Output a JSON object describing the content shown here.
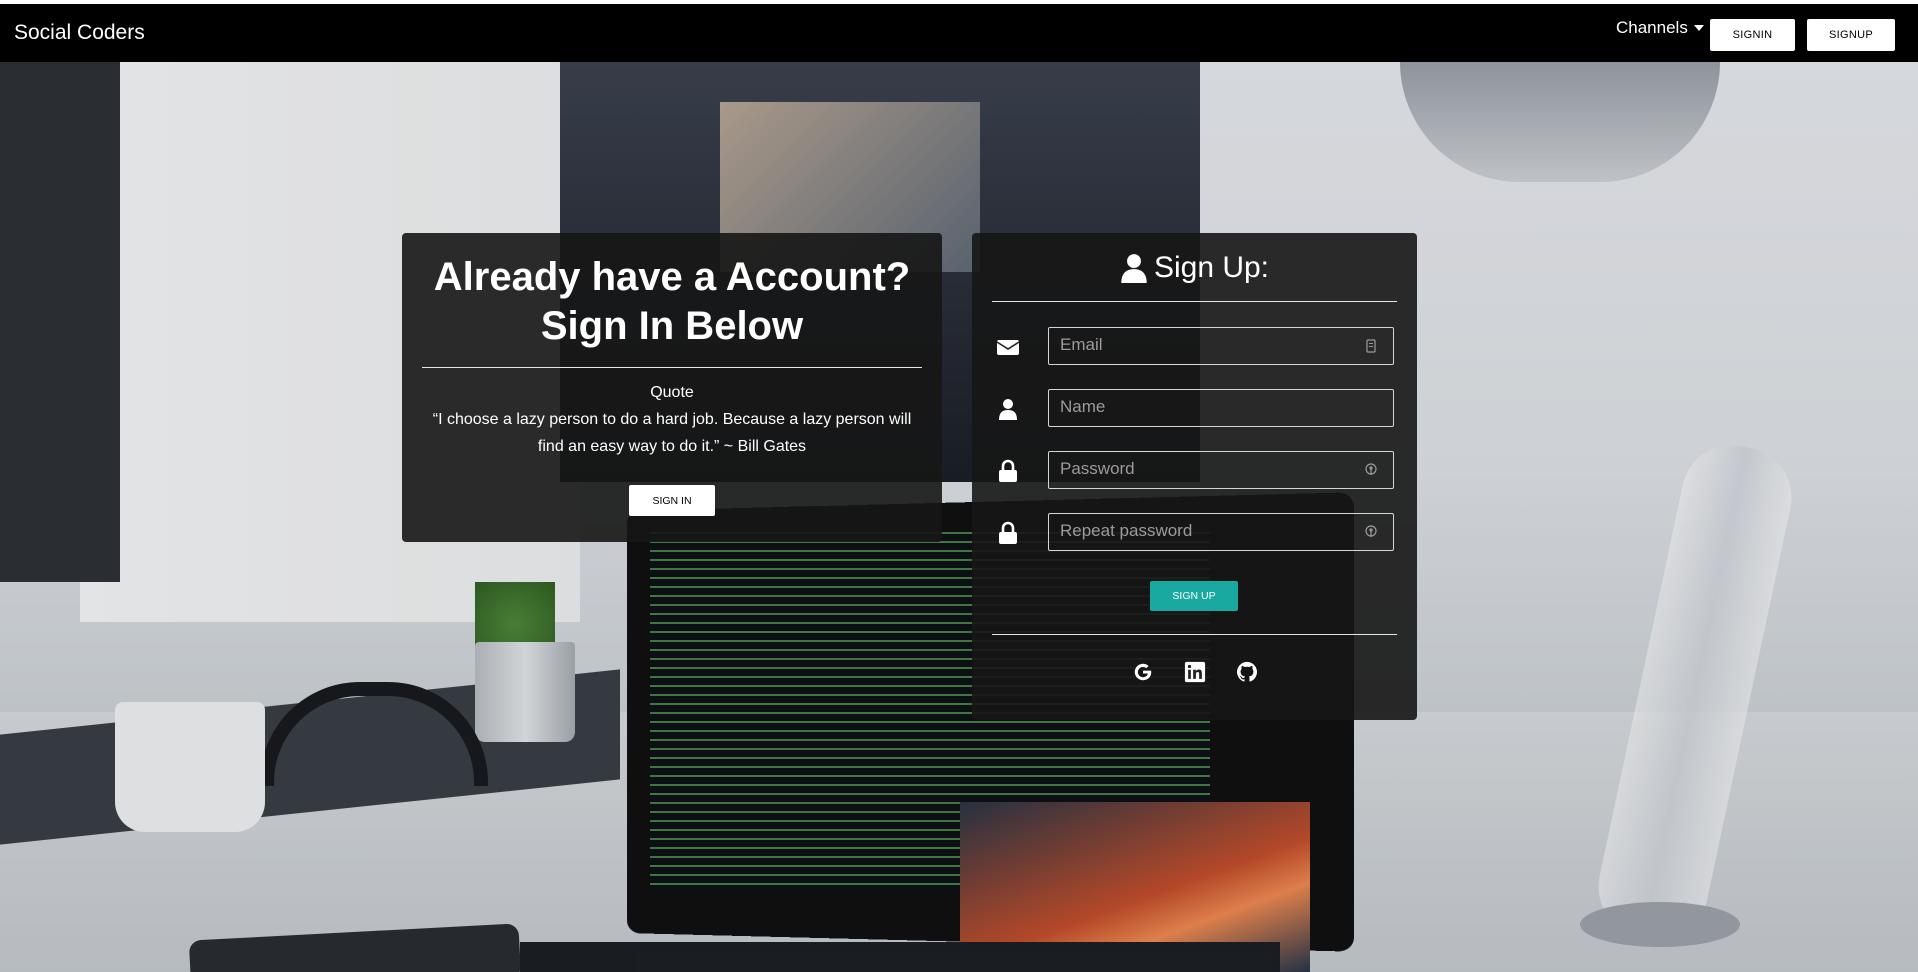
{
  "navbar": {
    "brand": "Social Coders",
    "channels_label": "Channels",
    "signin_label": "SIGNIN",
    "signup_label": "SIGNUP",
    "background": "#000000"
  },
  "signin_card": {
    "title_line1": "Already have a Account?",
    "title_line2": "Sign In Below",
    "quote_label": "Quote",
    "quote_text": "“I choose a lazy person to do a hard job. Because a lazy person will find an easy way to do it.” ~ Bill Gates",
    "button_label": "SIGN IN"
  },
  "signup_card": {
    "title": "Sign Up:",
    "fields": [
      {
        "icon": "envelope-icon",
        "placeholder": "Email",
        "value": ""
      },
      {
        "icon": "user-icon",
        "placeholder": "Name",
        "value": ""
      },
      {
        "icon": "lock-icon",
        "placeholder": "Password",
        "value": ""
      },
      {
        "icon": "lock-icon",
        "placeholder": "Repeat password",
        "value": ""
      }
    ],
    "button_label": "SIGN UP",
    "button_color": "#1aa9a1",
    "social_icons": [
      "google-icon",
      "linkedin-icon",
      "github-icon"
    ]
  }
}
